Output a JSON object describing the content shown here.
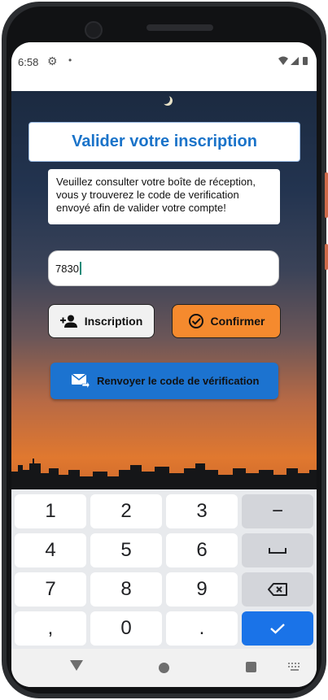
{
  "status_bar": {
    "time": "6:58",
    "dot": "•"
  },
  "form": {
    "title": "Valider votre inscription",
    "info_text": "Veuillez consulter votre boîte de réception, vous y trouverez le code de verification envoyé afin de valider votre compte!",
    "code_value": "7830"
  },
  "buttons": {
    "inscription": "Inscription",
    "confirmer": "Confirmer",
    "resend": "Renvoyer le code de vérification"
  },
  "keyboard": {
    "rows": [
      [
        "1",
        "2",
        "3",
        "−"
      ],
      [
        "4",
        "5",
        "6",
        "␣"
      ],
      [
        "7",
        "8",
        "9",
        "⌫"
      ],
      [
        ",",
        "0",
        ".",
        "✓"
      ]
    ]
  },
  "colors": {
    "title": "#1a73c9",
    "confirm_button": "#f58a2e",
    "resend_button": "#1c73d0",
    "enter_key": "#1a73e8"
  }
}
